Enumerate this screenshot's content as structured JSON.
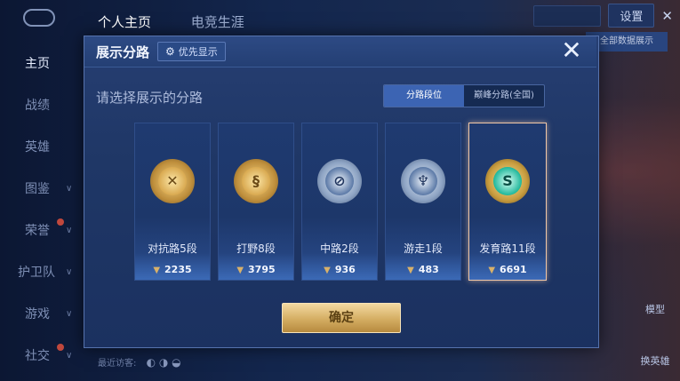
{
  "topnav": {
    "tab_profile": "个人主页",
    "tab_career": "电竞生涯"
  },
  "topbar": {
    "settings_label": "设置",
    "close_glyph": "✕"
  },
  "sidebar": {
    "items": [
      {
        "label": "主页"
      },
      {
        "label": "战绩"
      },
      {
        "label": "英雄"
      },
      {
        "label": "图鉴"
      },
      {
        "label": "荣誉"
      },
      {
        "label": "护卫队"
      },
      {
        "label": "游戏"
      },
      {
        "label": "社交"
      }
    ]
  },
  "background": {
    "banner": "全部数据展示",
    "visitor_label": "最近访客:",
    "model_label": "模型",
    "switch_hero_label": "换英雄"
  },
  "dialog": {
    "title": "展示分路",
    "priority_label": "优先显示",
    "close_glyph": "✕",
    "subtitle": "请选择展示的分路",
    "toggle": {
      "option1": "分路段位",
      "option2": "巅峰分路(全国)",
      "selected": "分路段位"
    },
    "cards": [
      {
        "rank": "对抗路5段",
        "score": "2235",
        "badge": "gold-crossed-swords-icon",
        "selected": false
      },
      {
        "rank": "打野8段",
        "score": "3795",
        "badge": "gold-dragon-icon",
        "selected": false
      },
      {
        "rank": "中路2段",
        "score": "936",
        "badge": "silver-staff-icon",
        "selected": false
      },
      {
        "rank": "游走1段",
        "score": "483",
        "badge": "silver-wings-icon",
        "selected": false
      },
      {
        "rank": "发育路11段",
        "score": "6691",
        "badge": "emerald-s-icon",
        "selected": true
      }
    ],
    "confirm_label": "确定"
  },
  "colors": {
    "accent_gold": "#d4ad62",
    "dialog_bg": "#1f3766",
    "toggle_active": "#3c64b3",
    "selected_border": "#f1c7a6"
  }
}
